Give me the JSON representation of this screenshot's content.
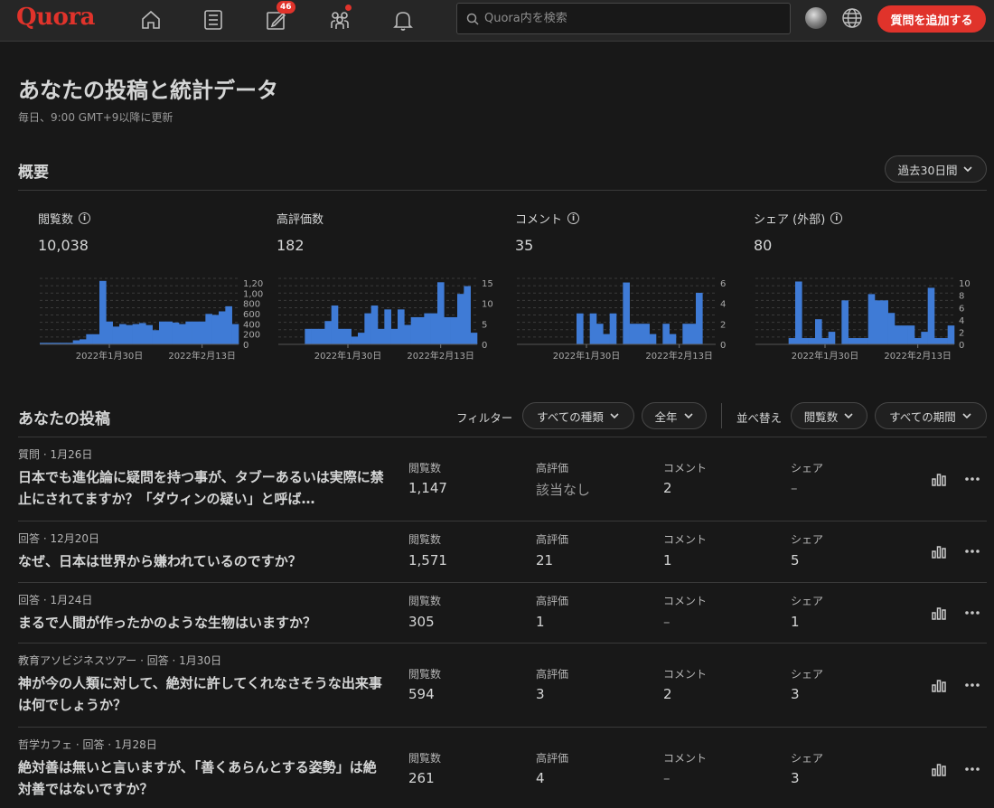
{
  "topbar": {
    "logo": "Quora",
    "write_badge": "46",
    "search_placeholder": "Quora内を検索",
    "add_question": "質問を追加する",
    "icons": [
      "home-icon",
      "list-icon",
      "edit-icon",
      "people-icon",
      "bell-icon",
      "globe-icon"
    ]
  },
  "page": {
    "title": "あなたの投稿と統計データ",
    "subtitle": "毎日、9:00 GMT+9以降に更新"
  },
  "overview": {
    "heading": "概要",
    "period": "過去30日間",
    "metrics": [
      {
        "label": "閲覧数",
        "value": "10,038"
      },
      {
        "label": "高評価数",
        "value": "182"
      },
      {
        "label": "コメント",
        "value": "35"
      },
      {
        "label": "シェア (外部)",
        "value": "80"
      }
    ]
  },
  "chart_data": [
    {
      "type": "bar",
      "x": [
        "2022-01-20",
        "2022-01-21",
        "2022-01-22",
        "2022-01-23",
        "2022-01-24",
        "2022-01-25",
        "2022-01-26",
        "2022-01-27",
        "2022-01-28",
        "2022-01-29",
        "2022-01-30",
        "2022-01-31",
        "2022-02-01",
        "2022-02-02",
        "2022-02-03",
        "2022-02-04",
        "2022-02-05",
        "2022-02-06",
        "2022-02-07",
        "2022-02-08",
        "2022-02-09",
        "2022-02-10",
        "2022-02-11",
        "2022-02-12",
        "2022-02-13",
        "2022-02-14",
        "2022-02-15",
        "2022-02-16",
        "2022-02-17",
        "2022-02-18"
      ],
      "values": [
        30,
        30,
        30,
        30,
        30,
        80,
        100,
        200,
        200,
        1250,
        450,
        350,
        400,
        380,
        400,
        420,
        380,
        280,
        450,
        450,
        430,
        400,
        450,
        450,
        450,
        600,
        580,
        650,
        750,
        400
      ],
      "xtick_labels": [
        "2022年1月30日",
        "2022年2月13日"
      ],
      "ytick_labels": [
        "0",
        "200",
        "400",
        "600",
        "800",
        "1,00",
        "1,20"
      ],
      "ylim": [
        0,
        1300
      ]
    },
    {
      "type": "bar",
      "x": [
        "2022-01-20",
        "2022-01-21",
        "2022-01-22",
        "2022-01-23",
        "2022-01-24",
        "2022-01-25",
        "2022-01-26",
        "2022-01-27",
        "2022-01-28",
        "2022-01-29",
        "2022-01-30",
        "2022-01-31",
        "2022-02-01",
        "2022-02-02",
        "2022-02-03",
        "2022-02-04",
        "2022-02-05",
        "2022-02-06",
        "2022-02-07",
        "2022-02-08",
        "2022-02-09",
        "2022-02-10",
        "2022-02-11",
        "2022-02-12",
        "2022-02-13",
        "2022-02-14",
        "2022-02-15",
        "2022-02-16",
        "2022-02-17",
        "2022-02-18"
      ],
      "values": [
        0,
        0,
        0,
        0,
        4,
        4,
        4,
        6,
        10,
        4,
        4,
        2,
        3,
        8,
        10,
        4,
        9,
        4,
        9,
        5,
        7,
        7,
        8,
        8,
        16,
        7,
        7,
        13,
        15,
        3
      ],
      "xtick_labels": [
        "2022年1月30日",
        "2022年2月13日"
      ],
      "ytick_labels": [
        "0",
        "5",
        "10",
        "15"
      ],
      "ylim": [
        0,
        17
      ]
    },
    {
      "type": "bar",
      "x": [
        "2022-01-20",
        "2022-01-21",
        "2022-01-22",
        "2022-01-23",
        "2022-01-24",
        "2022-01-25",
        "2022-01-26",
        "2022-01-27",
        "2022-01-28",
        "2022-01-29",
        "2022-01-30",
        "2022-01-31",
        "2022-02-01",
        "2022-02-02",
        "2022-02-03",
        "2022-02-04",
        "2022-02-05",
        "2022-02-06",
        "2022-02-07",
        "2022-02-08",
        "2022-02-09",
        "2022-02-10",
        "2022-02-11",
        "2022-02-12",
        "2022-02-13",
        "2022-02-14",
        "2022-02-15",
        "2022-02-16",
        "2022-02-17",
        "2022-02-18"
      ],
      "values": [
        0,
        0,
        0,
        0,
        0,
        0,
        0,
        0,
        0,
        3,
        0,
        3,
        2,
        1,
        3,
        0,
        6,
        2,
        2,
        2,
        1,
        0,
        2,
        1,
        0,
        2,
        2,
        5,
        0,
        0
      ],
      "xtick_labels": [
        "2022年1月30日",
        "2022年2月13日"
      ],
      "ytick_labels": [
        "0",
        "2",
        "4",
        "6"
      ],
      "ylim": [
        0,
        6.4
      ]
    },
    {
      "type": "bar",
      "x": [
        "2022-01-20",
        "2022-01-21",
        "2022-01-22",
        "2022-01-23",
        "2022-01-24",
        "2022-01-25",
        "2022-01-26",
        "2022-01-27",
        "2022-01-28",
        "2022-01-29",
        "2022-01-30",
        "2022-01-31",
        "2022-02-01",
        "2022-02-02",
        "2022-02-03",
        "2022-02-04",
        "2022-02-05",
        "2022-02-06",
        "2022-02-07",
        "2022-02-08",
        "2022-02-09",
        "2022-02-10",
        "2022-02-11",
        "2022-02-12",
        "2022-02-13",
        "2022-02-14",
        "2022-02-15",
        "2022-02-16",
        "2022-02-17",
        "2022-02-18"
      ],
      "values": [
        0,
        0,
        0,
        0,
        0,
        1,
        10,
        1,
        1,
        4,
        1,
        2,
        0,
        7,
        1,
        1,
        1,
        8,
        7,
        7,
        5,
        3,
        3,
        3,
        1,
        2,
        9,
        1,
        1,
        3
      ],
      "xtick_labels": [
        "2022年1月30日",
        "2022年2月13日"
      ],
      "ytick_labels": [
        "0",
        "2",
        "4",
        "6",
        "8",
        "10"
      ],
      "ylim": [
        0,
        10.5
      ]
    }
  ],
  "posts_section": {
    "heading": "あなたの投稿",
    "filter_label": "フィルター",
    "type_filter": "すべての種類",
    "year_filter": "全年",
    "sort_label": "並べ替え",
    "sort_by": "閲覧数",
    "period_filter": "すべての期間"
  },
  "columns": {
    "views": "閲覧数",
    "upvotes": "高評価",
    "comments": "コメント",
    "shares": "シェア"
  },
  "posts": [
    {
      "meta": "質問 · 1月26日",
      "title": "日本でも進化論に疑問を持つ事が、タブーあるいは実際に禁止にされてますか？「ダウィンの疑い」と呼ば…",
      "views": "1,147",
      "upvotes": "該当なし",
      "comments": "2",
      "shares": "–"
    },
    {
      "meta": "回答 · 12月20日",
      "title": "なぜ、日本は世界から嫌われているのですか？",
      "views": "1,571",
      "upvotes": "21",
      "comments": "1",
      "shares": "5"
    },
    {
      "meta": "回答 · 1月24日",
      "title": "まるで人間が作ったかのような生物はいますか？",
      "views": "305",
      "upvotes": "1",
      "comments": "–",
      "shares": "1"
    },
    {
      "meta": "教育アソビジネスツアー · 回答 · 1月30日",
      "title": "神が今の人類に対して、絶対に許してくれなさそうな出来事は何でしょうか？",
      "views": "594",
      "upvotes": "3",
      "comments": "2",
      "shares": "3"
    },
    {
      "meta": "哲学カフェ · 回答 · 1月28日",
      "title": "絶対善は無いと言いますが、「善くあらんとする姿勢」は絶対善ではないですか？",
      "views": "261",
      "upvotes": "4",
      "comments": "–",
      "shares": "3"
    }
  ]
}
